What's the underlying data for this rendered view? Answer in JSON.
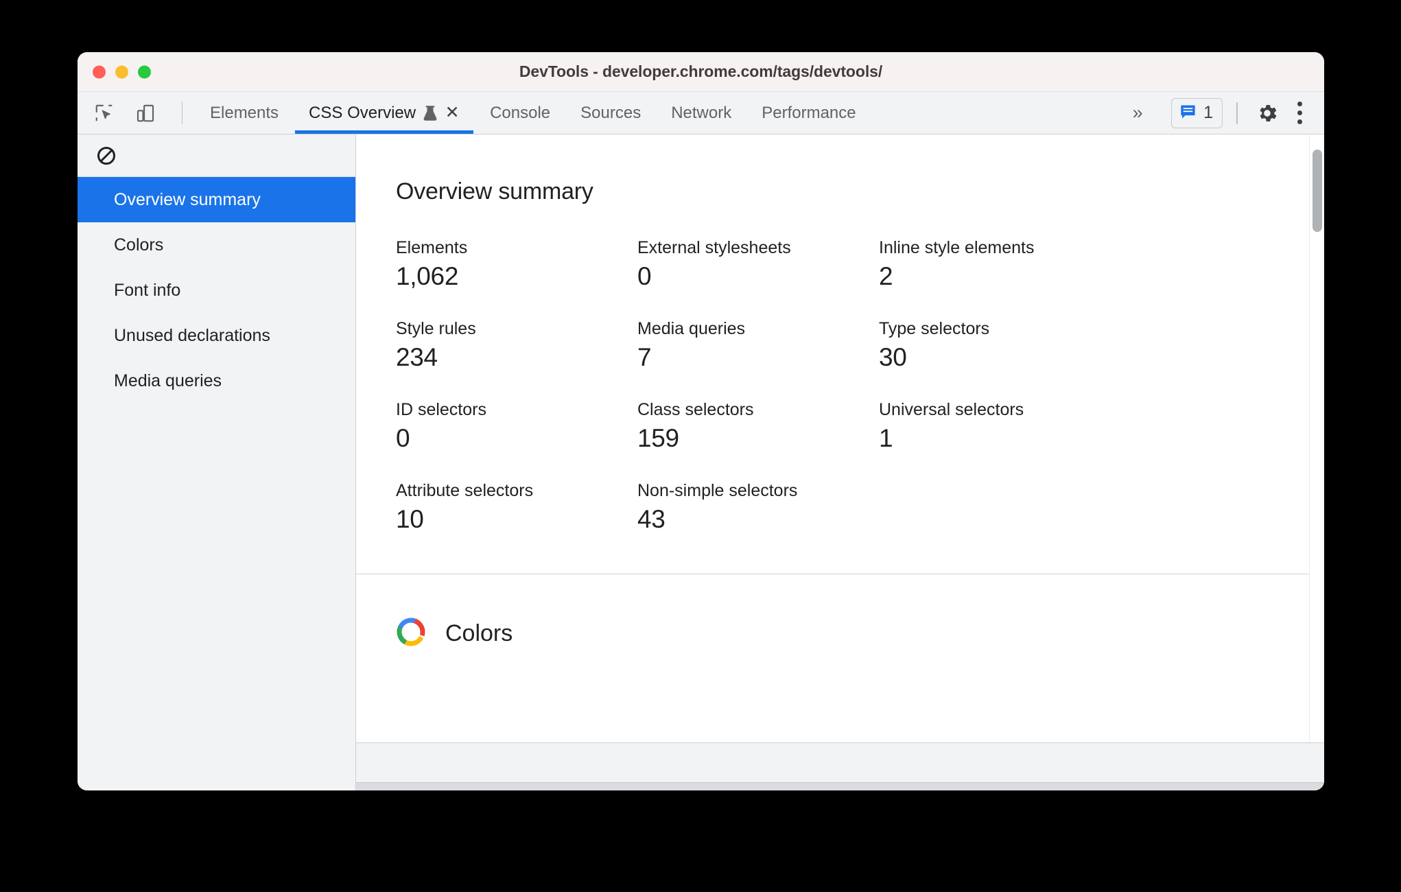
{
  "window": {
    "title": "DevTools - developer.chrome.com/tags/devtools/",
    "traffic_lights": [
      "close",
      "minimize",
      "zoom"
    ]
  },
  "toolbar": {
    "inspect_icon": "inspect-cursor-icon",
    "device_icon": "device-toolbar-icon",
    "tabs": [
      {
        "label": "Elements",
        "active": false
      },
      {
        "label": "CSS Overview",
        "active": true,
        "experimental": true,
        "closable": true
      },
      {
        "label": "Console",
        "active": false
      },
      {
        "label": "Sources",
        "active": false
      },
      {
        "label": "Network",
        "active": false
      },
      {
        "label": "Performance",
        "active": false
      }
    ],
    "overflow_label": "»",
    "message_count": "1",
    "message_icon": "message-bubble-icon",
    "settings_icon": "gear-icon",
    "more_icon": "more-vertical-icon",
    "close_tab_label": "✕"
  },
  "sidebar": {
    "clear_icon": "clear-overview-icon",
    "items": [
      {
        "label": "Overview summary",
        "selected": true
      },
      {
        "label": "Colors",
        "selected": false
      },
      {
        "label": "Font info",
        "selected": false
      },
      {
        "label": "Unused declarations",
        "selected": false
      },
      {
        "label": "Media queries",
        "selected": false
      }
    ]
  },
  "main": {
    "summary": {
      "title": "Overview summary",
      "stats": [
        {
          "label": "Elements",
          "value": "1,062"
        },
        {
          "label": "External stylesheets",
          "value": "0"
        },
        {
          "label": "Inline style elements",
          "value": "2"
        },
        {
          "label": "Style rules",
          "value": "234"
        },
        {
          "label": "Media queries",
          "value": "7"
        },
        {
          "label": "Type selectors",
          "value": "30"
        },
        {
          "label": "ID selectors",
          "value": "0"
        },
        {
          "label": "Class selectors",
          "value": "159"
        },
        {
          "label": "Universal selectors",
          "value": "1"
        },
        {
          "label": "Attribute selectors",
          "value": "10"
        },
        {
          "label": "Non-simple selectors",
          "value": "43"
        }
      ]
    },
    "colors_section": {
      "title": "Colors",
      "icon": "color-wheel-icon"
    }
  },
  "colors": {
    "accent_blue": "#1a73e8",
    "toolbar_bg": "#f1f3f4",
    "titlebar_bg": "#f7f2f2",
    "text_primary": "#202124",
    "text_secondary": "#5f6368",
    "divider": "#cdd1d9",
    "traffic_red": "#ff5f57",
    "traffic_yellow": "#f9bd2e",
    "traffic_green": "#28c840"
  }
}
